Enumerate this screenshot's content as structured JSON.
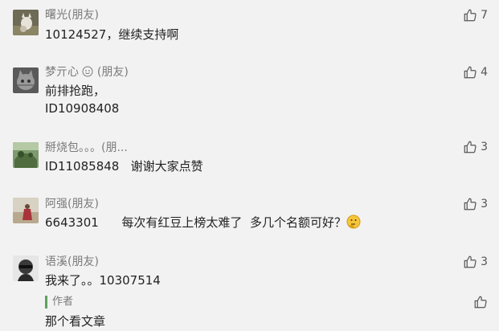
{
  "comments": [
    {
      "name": "曙光(朋友)",
      "lines": [
        "10124527，继续支持啊"
      ],
      "likes": "7"
    },
    {
      "name": "梦亓心",
      "suffix": "(朋友)",
      "lines": [
        "前排抢跑，",
        "ID10908408"
      ],
      "likes": "4"
    },
    {
      "name": "掰烧包。。。(朋...",
      "lines": [
        "ID11085848   谢谢大家点赞"
      ],
      "likes": "3"
    },
    {
      "name": "阿强(朋友)",
      "lines": [
        "6643301      每次有红豆上榜太难了  多几个名额可好？"
      ],
      "likes": "3"
    },
    {
      "name": "语溪(朋友)",
      "lines": [
        "我来了。。10307514"
      ],
      "likes": "3"
    }
  ],
  "author_reply": {
    "label": "作者",
    "text": "那个看文章"
  },
  "icons": {
    "like": "thumbs-up-icon",
    "badge": "smiley-badge-icon",
    "emoji": "thinking-emoji-icon"
  }
}
